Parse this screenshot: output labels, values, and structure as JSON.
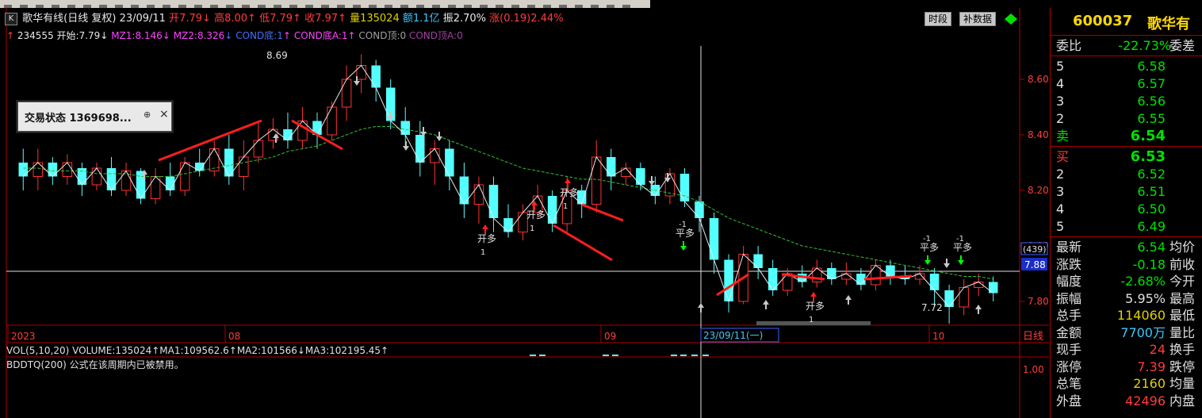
{
  "header": {
    "kline_button": "K",
    "title": "歌华有线(日线 复权)",
    "date": "23/09/11",
    "open": "开7.79",
    "high": "高8.00",
    "low": "低7.79",
    "close": "收7.97",
    "volume": "量135024",
    "amount": "额1.1亿",
    "amplitude": "振2.70%",
    "change": "涨(0.19)2.44%",
    "btn_period": "时段",
    "btn_data": "补数据"
  },
  "indicator_line": {
    "id": "234555",
    "open_start": "开始:7.79",
    "mz1": "MZ1:8.146",
    "mz2": "MZ2:8.326",
    "cond_di": "COND底:1",
    "cond_dia": "COND底A:1",
    "cond_ding": "COND顶:0",
    "cond_dinga": "COND顶A:0"
  },
  "popup": {
    "title": "交易状态 1369698...",
    "pin": "⊕",
    "close": "×"
  },
  "chart_data": {
    "type": "candlestick",
    "ylim": [
      7.72,
      8.72
    ],
    "yticks": [
      "8.60",
      "8.40",
      "8.20",
      "8.00",
      "7.80"
    ],
    "cursor_price": "7.88",
    "cursor_count": "(439)",
    "x_labels": [
      "2023",
      "08",
      "09",
      "10"
    ],
    "cursor_date": "23/09/11(一)",
    "period_label": "日线",
    "annotations": {
      "high_mark": "8.69",
      "low_mark": "7.72",
      "open_long": "开多",
      "close_long": "平多",
      "one": "1",
      "minus_one": "-1"
    },
    "candles": [
      [
        8.3,
        8.25,
        8.35,
        8.2
      ],
      [
        8.25,
        8.3,
        8.35,
        8.2
      ],
      [
        8.3,
        8.25,
        8.32,
        8.22
      ],
      [
        8.25,
        8.3,
        8.33,
        8.22
      ],
      [
        8.28,
        8.22,
        8.3,
        8.18
      ],
      [
        8.22,
        8.28,
        8.3,
        8.2
      ],
      [
        8.28,
        8.2,
        8.32,
        8.18
      ],
      [
        8.2,
        8.27,
        8.3,
        8.18
      ],
      [
        8.27,
        8.17,
        8.28,
        8.15
      ],
      [
        8.17,
        8.25,
        8.28,
        8.15
      ],
      [
        8.25,
        8.2,
        8.3,
        8.18
      ],
      [
        8.2,
        8.3,
        8.32,
        8.18
      ],
      [
        8.3,
        8.27,
        8.35,
        8.25
      ],
      [
        8.27,
        8.35,
        8.38,
        8.25
      ],
      [
        8.35,
        8.25,
        8.4,
        8.22
      ],
      [
        8.25,
        8.32,
        8.38,
        8.2
      ],
      [
        8.32,
        8.38,
        8.45,
        8.3
      ],
      [
        8.38,
        8.42,
        8.46,
        8.35
      ],
      [
        8.42,
        8.38,
        8.48,
        8.35
      ],
      [
        8.38,
        8.45,
        8.5,
        8.35
      ],
      [
        8.45,
        8.4,
        8.48,
        8.35
      ],
      [
        8.4,
        8.5,
        8.52,
        8.38
      ],
      [
        8.5,
        8.6,
        8.65,
        8.45
      ],
      [
        8.6,
        8.65,
        8.69,
        8.55
      ],
      [
        8.65,
        8.57,
        8.67,
        8.52
      ],
      [
        8.57,
        8.45,
        8.6,
        8.42
      ],
      [
        8.45,
        8.4,
        8.5,
        8.35
      ],
      [
        8.4,
        8.3,
        8.45,
        8.25
      ],
      [
        8.3,
        8.35,
        8.38,
        8.22
      ],
      [
        8.35,
        8.25,
        8.38,
        8.2
      ],
      [
        8.25,
        8.15,
        8.3,
        8.1
      ],
      [
        8.15,
        8.22,
        8.25,
        8.08
      ],
      [
        8.22,
        8.1,
        8.25,
        8.05
      ],
      [
        8.1,
        8.05,
        8.15,
        8.03
      ],
      [
        8.05,
        8.12,
        8.15,
        8.02
      ],
      [
        8.12,
        8.18,
        8.22,
        8.1
      ],
      [
        8.18,
        8.08,
        8.2,
        8.05
      ],
      [
        8.08,
        8.2,
        8.25,
        8.05
      ],
      [
        8.2,
        8.15,
        8.22,
        8.1
      ],
      [
        8.15,
        8.32,
        8.38,
        8.12
      ],
      [
        8.32,
        8.25,
        8.35,
        8.2
      ],
      [
        8.25,
        8.28,
        8.3,
        8.22
      ],
      [
        8.28,
        8.22,
        8.3,
        8.2
      ],
      [
        8.22,
        8.18,
        8.25,
        8.15
      ],
      [
        8.18,
        8.26,
        8.28,
        8.15
      ],
      [
        8.26,
        8.16,
        8.28,
        8.14
      ],
      [
        8.16,
        8.1,
        8.18,
        8.05
      ],
      [
        8.1,
        7.95,
        8.12,
        7.9
      ],
      [
        7.95,
        7.8,
        7.97,
        7.76
      ],
      [
        7.8,
        7.97,
        8.0,
        7.79
      ],
      [
        7.97,
        7.92,
        8.0,
        7.88
      ],
      [
        7.92,
        7.84,
        7.95,
        7.82
      ],
      [
        7.84,
        7.9,
        7.92,
        7.82
      ],
      [
        7.9,
        7.87,
        7.93,
        7.85
      ],
      [
        7.87,
        7.92,
        7.95,
        7.85
      ],
      [
        7.92,
        7.88,
        7.94,
        7.86
      ],
      [
        7.88,
        7.9,
        7.94,
        7.86
      ],
      [
        7.9,
        7.86,
        7.92,
        7.84
      ],
      [
        7.86,
        7.93,
        7.95,
        7.84
      ],
      [
        7.93,
        7.89,
        7.95,
        7.86
      ],
      [
        7.89,
        7.88,
        7.93,
        7.86
      ],
      [
        7.88,
        7.9,
        7.93,
        7.86
      ],
      [
        7.9,
        7.84,
        7.92,
        7.78
      ],
      [
        7.84,
        7.78,
        7.86,
        7.72
      ],
      [
        7.78,
        7.85,
        7.88,
        7.75
      ],
      [
        7.85,
        7.87,
        7.9,
        7.82
      ],
      [
        7.87,
        7.83,
        7.89,
        7.8
      ]
    ],
    "ma": [
      8.28,
      8.28,
      8.27,
      8.27,
      8.27,
      8.26,
      8.26,
      8.26,
      8.25,
      8.25,
      8.25,
      8.26,
      8.27,
      8.28,
      8.29,
      8.3,
      8.31,
      8.32,
      8.34,
      8.35,
      8.36,
      8.38,
      8.4,
      8.42,
      8.43,
      8.43,
      8.42,
      8.41,
      8.4,
      8.38,
      8.36,
      8.34,
      8.32,
      8.3,
      8.28,
      8.27,
      8.26,
      8.25,
      8.24,
      8.24,
      8.23,
      8.22,
      8.21,
      8.2,
      8.19,
      8.18,
      8.16,
      8.13,
      8.1,
      8.08,
      8.06,
      8.04,
      8.02,
      8.0,
      7.99,
      7.98,
      7.97,
      7.96,
      7.95,
      7.94,
      7.93,
      7.92,
      7.91,
      7.9,
      7.89,
      7.89,
      7.88
    ]
  },
  "sub": {
    "vol_line": "VOL(5,10,20) VOLUME:135024↑MA1:109562.6↑MA2:101566↓MA3:102195.45↑",
    "bddtq_line": "BDDTQ(200)  公式在该周期内已被禁用。",
    "tick_100": "1.00"
  },
  "right_panel": {
    "code": "600037",
    "name": "歌华有",
    "ratio_label": "委比",
    "ratio_value": "-22.73%",
    "diff_label": "委差",
    "sells": [
      {
        "level": "5",
        "price": "6.58"
      },
      {
        "level": "4",
        "price": "6.57"
      },
      {
        "level": "3",
        "price": "6.56"
      },
      {
        "level": "2",
        "price": "6.55"
      },
      {
        "level": "卖",
        "price": "6.54"
      }
    ],
    "buys": [
      {
        "level": "买",
        "price": "6.53"
      },
      {
        "level": "2",
        "price": "6.52"
      },
      {
        "level": "3",
        "price": "6.51"
      },
      {
        "level": "4",
        "price": "6.50"
      },
      {
        "level": "5",
        "price": "6.49"
      }
    ],
    "stats": [
      {
        "l": "最新",
        "v": "6.54",
        "r": "均价",
        "color": "#00e000"
      },
      {
        "l": "涨跌",
        "v": "-0.18",
        "r": "前收",
        "color": "#00e000"
      },
      {
        "l": "幅度",
        "v": "-2.68%",
        "r": "今开",
        "color": "#00e000"
      },
      {
        "l": "振幅",
        "v": "5.95%",
        "r": "最高",
        "color": "#e0e0e0"
      },
      {
        "l": "总手",
        "v": "114060",
        "r": "最低",
        "color": "#e0d000"
      },
      {
        "l": "金额",
        "v": "7700万",
        "r": "量比",
        "color": "#3cc8ff"
      },
      {
        "l": "现手",
        "v": "24",
        "r": "换手",
        "color": "#ff3c3c"
      },
      {
        "l": "涨停",
        "v": "7.39",
        "r": "跌停",
        "color": "#ff3c3c"
      },
      {
        "l": "总笔",
        "v": "2160",
        "r": "均量",
        "color": "#e0d000"
      },
      {
        "l": "外盘",
        "v": "42496",
        "r": "内盘",
        "color": "#ff3c3c"
      }
    ]
  }
}
